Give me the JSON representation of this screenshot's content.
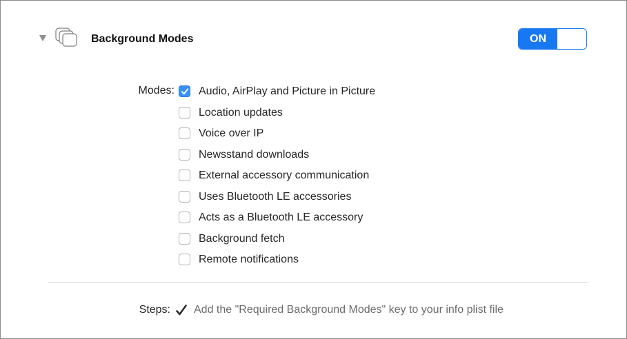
{
  "section": {
    "title": "Background Modes",
    "icon": "capabilities-stack-icon",
    "expanded": true,
    "toggle": {
      "label": "ON",
      "state": true,
      "accent_color": "#1878f2"
    }
  },
  "modes": {
    "label": "Modes:",
    "items": [
      {
        "label": "Audio, AirPlay and Picture in Picture",
        "checked": true
      },
      {
        "label": "Location updates",
        "checked": false
      },
      {
        "label": "Voice over IP",
        "checked": false
      },
      {
        "label": "Newsstand downloads",
        "checked": false
      },
      {
        "label": "External accessory communication",
        "checked": false
      },
      {
        "label": "Uses Bluetooth LE accessories",
        "checked": false
      },
      {
        "label": "Acts as a Bluetooth LE accessory",
        "checked": false
      },
      {
        "label": "Background fetch",
        "checked": false
      },
      {
        "label": "Remote notifications",
        "checked": false
      }
    ]
  },
  "steps": {
    "label": "Steps:",
    "icon": "checkmark-icon",
    "items": [
      {
        "text": "Add the \"Required Background Modes\" key to your info plist file",
        "done": true
      }
    ]
  }
}
